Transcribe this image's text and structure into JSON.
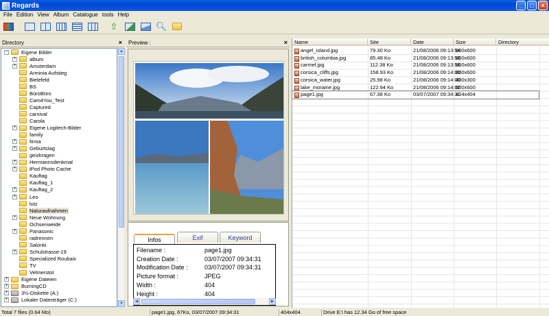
{
  "window": {
    "title": "Regards"
  },
  "menu": [
    "File",
    "Edition",
    "View",
    "Album",
    "Catalogue",
    "tools",
    "Help"
  ],
  "toolbar": {
    "buttons": [
      "palette-icon",
      "single-view-icon",
      "split-view-icon",
      "filmstrip-icon",
      "list-view-icon",
      "grid-view-icon",
      "up-folder-icon",
      "export-icon",
      "slideshow-icon",
      "search-icon",
      "folder-open-icon"
    ]
  },
  "directory": {
    "title": "Directory",
    "root": "Eigene Bilder",
    "items": [
      {
        "label": "album",
        "exp": true
      },
      {
        "label": "Amsterdam",
        "exp": true
      },
      {
        "label": "Arminia Aufstieg",
        "exp": false
      },
      {
        "label": "Bielefeld",
        "exp": false
      },
      {
        "label": "BS",
        "exp": false
      },
      {
        "label": "BüroBüro",
        "exp": false
      },
      {
        "label": "Cam4You_Test",
        "exp": false
      },
      {
        "label": "Captured",
        "exp": false
      },
      {
        "label": "carnival",
        "exp": false
      },
      {
        "label": "Carola",
        "exp": false
      },
      {
        "label": "Eigene Logitech-Bilder",
        "exp": true
      },
      {
        "label": "family",
        "exp": false
      },
      {
        "label": "firma",
        "exp": true
      },
      {
        "label": "Geburtstag",
        "exp": true
      },
      {
        "label": "geizkragen",
        "exp": false
      },
      {
        "label": "Hermannsdenkmal",
        "exp": true
      },
      {
        "label": "iPod Photo Cache",
        "exp": true
      },
      {
        "label": "Kauftag",
        "exp": false
      },
      {
        "label": "Kauftag_1",
        "exp": false
      },
      {
        "label": "Kauftag_2",
        "exp": true
      },
      {
        "label": "Leo",
        "exp": true
      },
      {
        "label": "lutz",
        "exp": false
      },
      {
        "label": "Naturaufnahmen",
        "exp": false,
        "selected": true
      },
      {
        "label": "Neue Wohnung",
        "exp": true
      },
      {
        "label": "Ochsenweide",
        "exp": false
      },
      {
        "label": "Panasonic",
        "exp": true
      },
      {
        "label": "radrennen",
        "exp": false
      },
      {
        "label": "Salonki",
        "exp": false
      },
      {
        "label": "Schulstrasse-19",
        "exp": true
      },
      {
        "label": "Specialized Roubaix",
        "exp": false
      },
      {
        "label": "TV",
        "exp": false
      },
      {
        "label": "Velmerstot",
        "exp": false
      }
    ],
    "others": [
      {
        "label": "Eigene Dateien",
        "exp": true,
        "drive": false
      },
      {
        "label": "BurningCD",
        "exp": true,
        "drive": false
      },
      {
        "label": "3½-Diskette (A:)",
        "exp": true,
        "drive": true
      },
      {
        "label": "Lokaler Datenträger (C:)",
        "exp": true,
        "drive": true
      }
    ]
  },
  "preview": {
    "title": "Preview :",
    "tabs": [
      "Infos",
      "Exif",
      "Keyword"
    ],
    "info": [
      {
        "key": "Filename :",
        "value": "page1.jpg"
      },
      {
        "key": "Creation Date :",
        "value": "03/07/2007 09:34:31"
      },
      {
        "key": "Modification Date :",
        "value": "03/07/2007 09:34:31"
      },
      {
        "key": "Picture format :",
        "value": "JPEG"
      },
      {
        "key": "Width :",
        "value": "404"
      },
      {
        "key": "Height :",
        "value": "404"
      }
    ]
  },
  "files": {
    "columns": [
      "Name",
      "Site",
      "Date",
      "Size",
      "Directory"
    ],
    "rows": [
      {
        "name": "angel_island.jpg",
        "site": "79.30 Ko",
        "date": "21/08/2006 09:13:54",
        "size": "800x600"
      },
      {
        "name": "british_columbia.jpg",
        "site": "85.48 Ko",
        "date": "21/08/2006 09:13:56",
        "size": "800x600"
      },
      {
        "name": "carmel.jpg",
        "site": "112.38 Ko",
        "date": "21/08/2006 09:13:56",
        "size": "800x600"
      },
      {
        "name": "corsica_cliffs.jpg",
        "site": "158.93 Ko",
        "date": "21/08/2006 09:14:00",
        "size": "800x600"
      },
      {
        "name": "corsica_water.jpg",
        "site": "25.98 Ko",
        "date": "21/08/2006 09:14:00",
        "size": "400x300"
      },
      {
        "name": "lake_moraine.jpg",
        "site": "122.94 Ko",
        "date": "21/08/2006 09:14:02",
        "size": "800x600"
      },
      {
        "name": "page1.jpg",
        "site": "67.38 Ko",
        "date": "03/07/2007 09:34:31",
        "size": "404x404",
        "focused": true
      }
    ]
  },
  "status": {
    "total": "Total 7 files (0.64 Mo)",
    "selection": "page1.jpg, 67Ko, 03/07/2007 09:34:31",
    "dimensions": "404x404",
    "drive": "Drive E:\\ has 12.34 Go of free space"
  }
}
